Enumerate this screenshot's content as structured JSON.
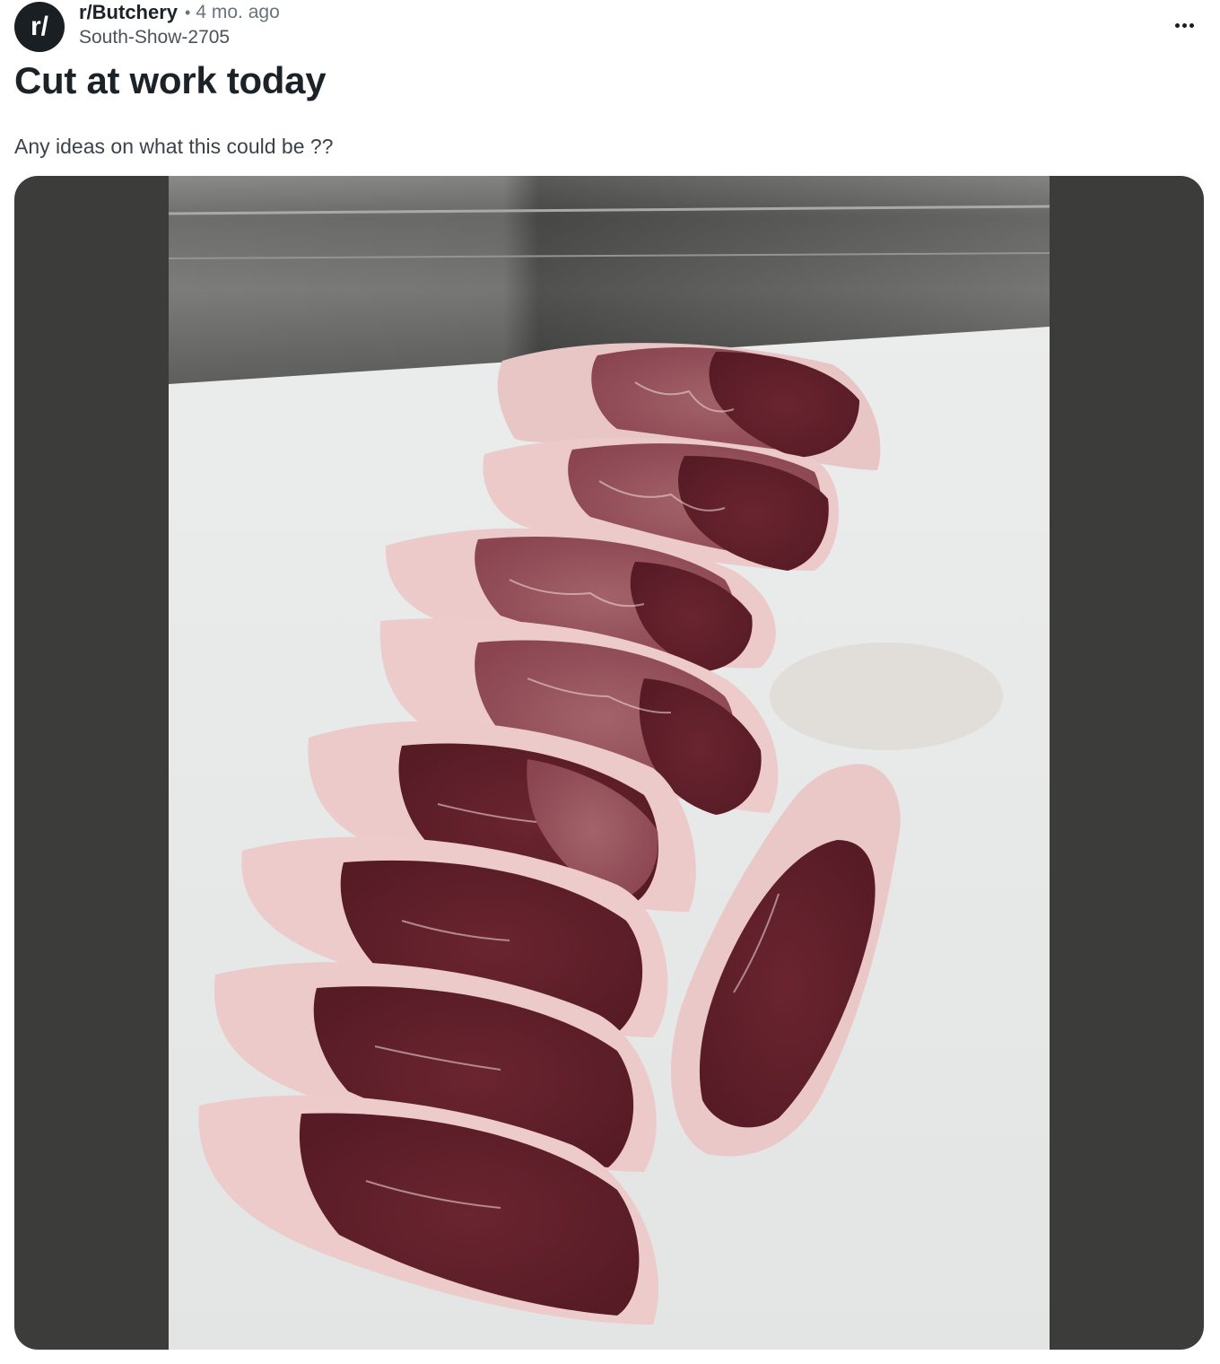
{
  "post": {
    "subreddit": "r/Butchery",
    "separator": "•",
    "age": "4 mo. ago",
    "author": "South-Show-2705",
    "title": "Cut at work today",
    "body": "Any ideas on what this could be ??",
    "avatar_text": "r/"
  },
  "icons": {
    "avatar": "subreddit-avatar-icon",
    "menu": "more-options-icon"
  },
  "colors": {
    "media_background": "#3c3c3b",
    "avatar_background": "#1a1f24"
  }
}
